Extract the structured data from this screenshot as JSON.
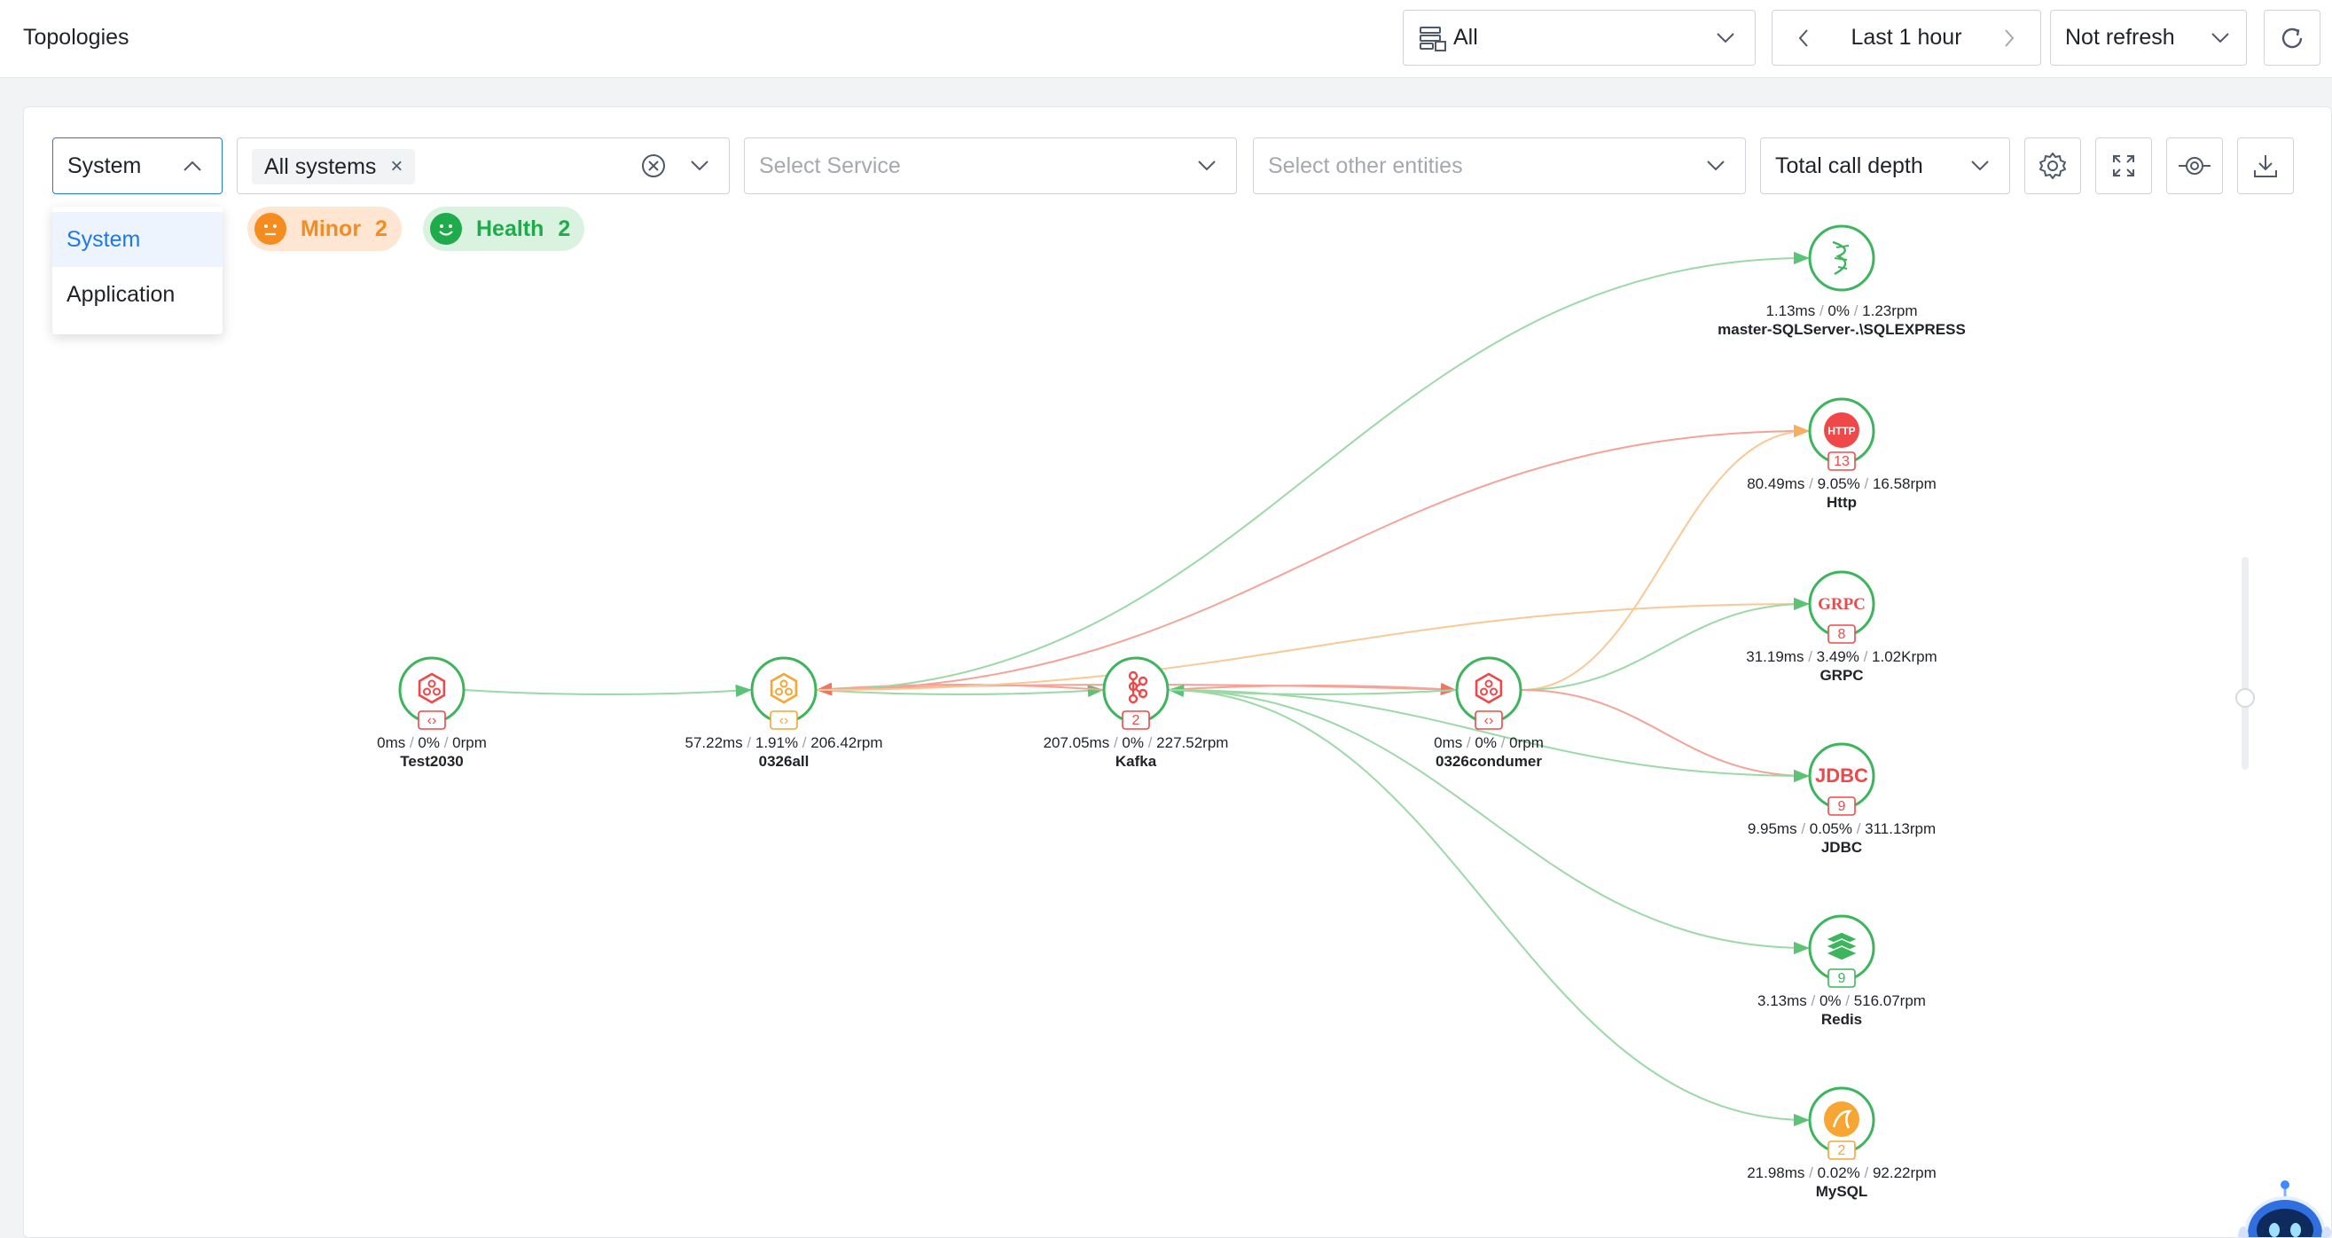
{
  "header": {
    "title": "Topologies",
    "system_select": "All",
    "time_range": "Last 1 hour",
    "refresh": "Not refresh"
  },
  "filters": {
    "mode": "System",
    "systems_tag": "All systems",
    "service_placeholder": "Select Service",
    "entities_placeholder": "Select other entities",
    "depth": "Total call depth"
  },
  "mode_menu": {
    "items": [
      "System",
      "Application"
    ],
    "selected": "System"
  },
  "status_pills": [
    {
      "label": "Minor",
      "count": "2",
      "color": "#f58c1f"
    },
    {
      "label": "Health",
      "count": "2",
      "color": "#1fab4b"
    }
  ],
  "colors": {
    "green": "#3cb55c",
    "red": "#f04848",
    "orange": "#f7a533",
    "edge_green": "#9bd9a6",
    "edge_red": "#f5a397",
    "edge_orange": "#f9c894",
    "accent": "#1f78e8"
  },
  "nodes": [
    {
      "id": "test2030",
      "name": "Test2030",
      "latency": "0ms",
      "error": "0%",
      "rpm": "0rpm",
      "icon": "service-hex-icon",
      "color": "red",
      "badge": "‹›"
    },
    {
      "id": "all0326",
      "name": "0326all",
      "latency": "57.22ms",
      "error": "1.91%",
      "rpm": "206.42rpm",
      "icon": "service-hex-icon",
      "color": "orange",
      "badge": "‹›"
    },
    {
      "id": "kafka",
      "name": "Kafka",
      "latency": "207.05ms",
      "error": "0%",
      "rpm": "227.52rpm",
      "icon": "kafka-icon",
      "color": "red",
      "badge": "2"
    },
    {
      "id": "condumer",
      "name": "0326condumer",
      "latency": "0ms",
      "error": "0%",
      "rpm": "0rpm",
      "icon": "service-hex-icon",
      "color": "red",
      "badge": "‹›"
    },
    {
      "id": "sqlserver",
      "name": "master-SQLServer-.\\SQLEXPRESS",
      "latency": "1.13ms",
      "error": "0%",
      "rpm": "1.23rpm",
      "icon": "sqlserver-icon",
      "color": "green",
      "badge": ""
    },
    {
      "id": "http",
      "name": "Http",
      "latency": "80.49ms",
      "error": "9.05%",
      "rpm": "16.58rpm",
      "icon": "http-icon",
      "color": "red",
      "badge": "13",
      "icon_text": "HTTP"
    },
    {
      "id": "grpc",
      "name": "GRPC",
      "latency": "31.19ms",
      "error": "3.49%",
      "rpm": "1.02Krpm",
      "icon": "grpc-icon",
      "color": "red",
      "badge": "8",
      "icon_text": "GRPC"
    },
    {
      "id": "jdbc",
      "name": "JDBC",
      "latency": "9.95ms",
      "error": "0.05%",
      "rpm": "311.13rpm",
      "icon": "jdbc-icon",
      "color": "red",
      "badge": "9",
      "icon_text": "JDBC"
    },
    {
      "id": "redis",
      "name": "Redis",
      "latency": "3.13ms",
      "error": "0%",
      "rpm": "516.07rpm",
      "icon": "redis-icon",
      "color": "green",
      "badge": "9"
    },
    {
      "id": "mysql",
      "name": "MySQL",
      "latency": "21.98ms",
      "error": "0.02%",
      "rpm": "92.22rpm",
      "icon": "mysql-icon",
      "color": "orange",
      "badge": "2"
    }
  ],
  "edges": [
    {
      "from": "test2030",
      "to": "all0326",
      "color": "green"
    },
    {
      "from": "all0326",
      "to": "kafka",
      "color": "green"
    },
    {
      "from": "kafka",
      "to": "all0326",
      "color": "red"
    },
    {
      "from": "condumer",
      "to": "all0326",
      "color": "red"
    },
    {
      "from": "kafka",
      "to": "condumer",
      "color": "red"
    },
    {
      "from": "condumer",
      "to": "kafka",
      "color": "green"
    },
    {
      "from": "all0326",
      "to": "sqlserver",
      "color": "green"
    },
    {
      "from": "all0326",
      "to": "http",
      "color": "red"
    },
    {
      "from": "all0326",
      "to": "grpc",
      "color": "orange"
    },
    {
      "from": "condumer",
      "to": "http",
      "color": "orange"
    },
    {
      "from": "condumer",
      "to": "grpc",
      "color": "green"
    },
    {
      "from": "condumer",
      "to": "jdbc",
      "color": "red"
    },
    {
      "from": "kafka",
      "to": "jdbc",
      "color": "green"
    },
    {
      "from": "kafka",
      "to": "redis",
      "color": "green"
    },
    {
      "from": "kafka",
      "to": "mysql",
      "color": "green"
    }
  ]
}
